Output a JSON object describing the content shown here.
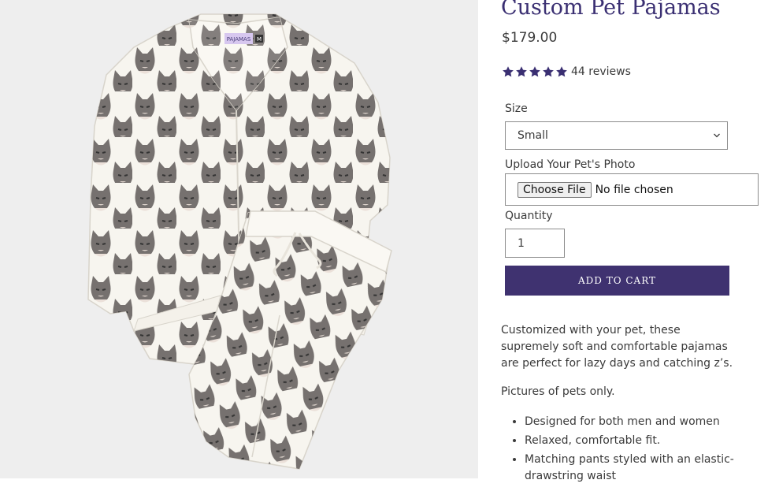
{
  "product": {
    "title": "Custom Pet Pajamas",
    "price": "$179.00",
    "rating": {
      "stars": 5,
      "reviews_label": "44 reviews"
    },
    "brand_color": "#3f3270",
    "image": {
      "tag_text": "PAJAMAS",
      "tag_size": "M"
    }
  },
  "form": {
    "size": {
      "label": "Size",
      "selected": "Small"
    },
    "upload": {
      "label": "Upload Your Pet's Photo",
      "button_label": "Choose File",
      "status": "No file chosen"
    },
    "quantity": {
      "label": "Quantity",
      "value": "1"
    },
    "add_to_cart_label": "ADD TO CART"
  },
  "description": {
    "intro": "Customized with your pet, these supremely soft and comfortable pajamas are perfect for lazy days and catching z’s.",
    "note": "Pictures of pets only.",
    "features": [
      "Designed for both men and women",
      "Relaxed, comfortable fit.",
      "Matching pants styled with an elastic-drawstring waist"
    ]
  },
  "icons": {
    "star": "star-icon",
    "select_arrow": "chevron-down-icon",
    "cat_pattern": "cat-face-icon"
  }
}
